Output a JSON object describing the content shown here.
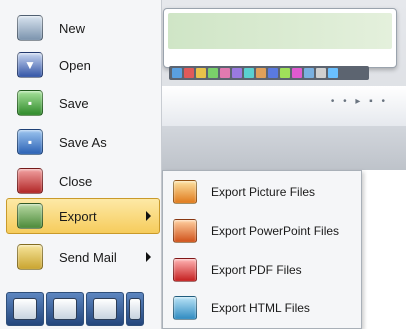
{
  "menu": {
    "items": [
      {
        "label": "New",
        "icon": "new-document-icon"
      },
      {
        "label": "Open",
        "icon": "open-folder-icon"
      },
      {
        "label": "Save",
        "icon": "save-disk-icon"
      },
      {
        "label": "Save As",
        "icon": "save-as-icon"
      },
      {
        "label": "Close",
        "icon": "close-document-icon"
      },
      {
        "label": "Export",
        "icon": "export-icon",
        "has_submenu": true,
        "active": true
      },
      {
        "label": "Send Mail",
        "icon": "mail-icon",
        "has_submenu": true
      }
    ],
    "active_color": "#f6cc5c"
  },
  "export_submenu": {
    "items": [
      {
        "label": "Export Picture Files",
        "icon": "picture-file-icon"
      },
      {
        "label": "Export PowerPoint Files",
        "icon": "powerpoint-file-icon"
      },
      {
        "label": "Export PDF Files",
        "icon": "pdf-file-icon"
      },
      {
        "label": "Export HTML Files",
        "icon": "html-file-icon"
      }
    ]
  },
  "bottom_toolbar": {
    "buttons": [
      "shapes-icon",
      "printer-icon",
      "print-preview-icon",
      "tool-icon"
    ]
  }
}
